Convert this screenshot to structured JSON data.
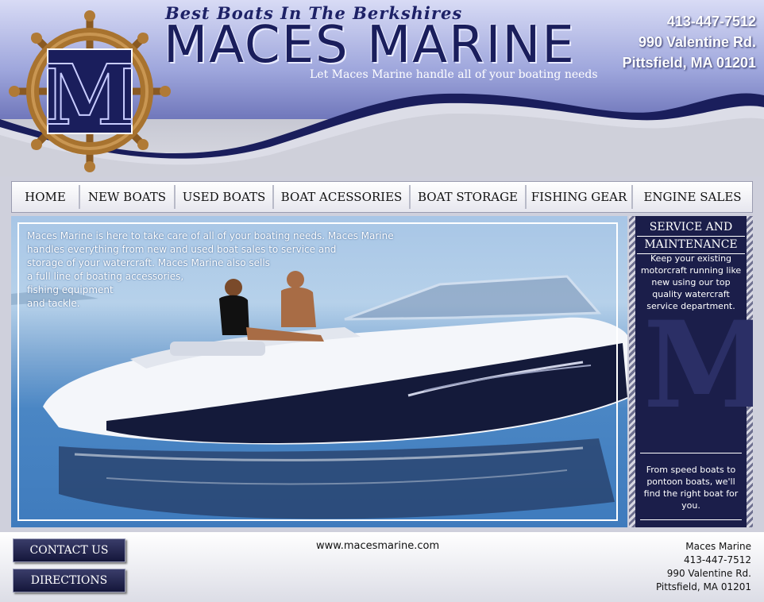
{
  "header": {
    "tagline": "Best  Boats In The Berkshires",
    "brand": "MACES MARINE",
    "slogan": "Let Maces Marine handle all of your boating needs",
    "logo_letter": "M",
    "phone": "413-447-7512",
    "street": "990 Valentine Rd.",
    "city": "Pittsfield, MA 01201"
  },
  "nav": {
    "items": [
      {
        "label": "HOME"
      },
      {
        "label": "NEW BOATS"
      },
      {
        "label": "USED BOATS"
      },
      {
        "label": "BOAT ACESSORIES"
      },
      {
        "label": "BOAT STORAGE"
      },
      {
        "label": "FISHING GEAR"
      },
      {
        "label": "ENGINE SALES"
      }
    ]
  },
  "hero": {
    "lines": [
      "Maces Marine is here to take care of all of your boating needs.  Maces Marine",
      "handles everything from new and used boat sales to service and",
      "storage of your watercraft. Maces Marine also sells",
      "a full line of boating accessories,",
      "fishing equipment",
      "and tackle."
    ]
  },
  "side": {
    "title_line1": "SERVICE AND",
    "title_line2": "MAINTENANCE",
    "text1": "Keep your existing motorcraft running like new using our top quality watercraft service department.",
    "text2": "From speed boats to pontoon boats, we'll find the right boat for you.",
    "watermark": "M"
  },
  "footer": {
    "contact_label": "CONTACT US",
    "directions_label": "DIRECTIONS",
    "website": "www.macesmarine.com",
    "company": "Maces Marine",
    "phone": "413-447-7512",
    "street": "990 Valentine Rd.",
    "city": "Pittsfield, MA 01201"
  },
  "colors": {
    "navy": "#1b1e4a",
    "brand_blue": "#1a1e5c",
    "wheel_bronze": "#a8732f"
  }
}
